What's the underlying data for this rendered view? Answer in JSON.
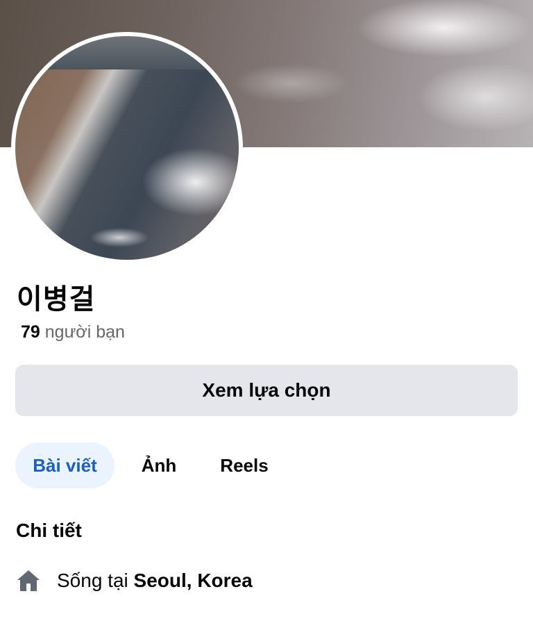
{
  "profile": {
    "name": "이병걸",
    "friends_count": "79",
    "friends_label": "người bạn"
  },
  "actions": {
    "options_label": "Xem lựa chọn"
  },
  "tabs": [
    {
      "label": "Bài viết",
      "active": true
    },
    {
      "label": "Ảnh",
      "active": false
    },
    {
      "label": "Reels",
      "active": false
    }
  ],
  "details": {
    "title": "Chi tiết",
    "lives_in": {
      "icon": "home-icon",
      "prefix": "Sống tại",
      "place": "Seoul, Korea"
    }
  },
  "colors": {
    "accent": "#1b5fbf",
    "active_tab_bg": "#ebf3fe",
    "button_bg": "#e4e6eb",
    "secondary_text": "#65676b"
  }
}
